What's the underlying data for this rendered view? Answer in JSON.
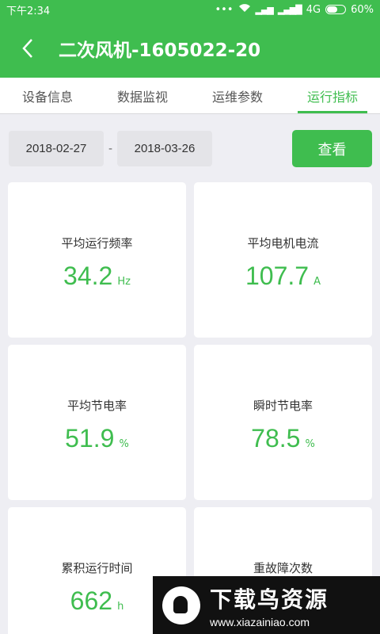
{
  "status_bar": {
    "time": "下午2:34",
    "network": "4G",
    "battery": "60%",
    "battery_level": 0.6
  },
  "app_bar": {
    "title": "二次风机-1605022-20"
  },
  "tabs": [
    {
      "label": "设备信息",
      "active": false
    },
    {
      "label": "数据监视",
      "active": false
    },
    {
      "label": "运维参数",
      "active": false
    },
    {
      "label": "运行指标",
      "active": true
    }
  ],
  "filter": {
    "start_date": "2018-02-27",
    "separator": "-",
    "end_date": "2018-03-26",
    "view_label": "查看"
  },
  "metrics": [
    {
      "label": "平均运行频率",
      "value": "34.2",
      "unit": "Hz"
    },
    {
      "label": "平均电机电流",
      "value": "107.7",
      "unit": "A"
    },
    {
      "label": "平均节电率",
      "value": "51.9",
      "unit": "%"
    },
    {
      "label": "瞬时节电率",
      "value": "78.5",
      "unit": "%"
    },
    {
      "label": "累积运行时间",
      "value": "662",
      "unit": "h"
    },
    {
      "label": "重故障次数",
      "value": "",
      "unit": ""
    }
  ],
  "watermark": {
    "name": "下载鸟资源",
    "url": "www.xiazainiao.com"
  },
  "colors": {
    "accent": "#3fbd4f",
    "background": "#eeeef3"
  }
}
